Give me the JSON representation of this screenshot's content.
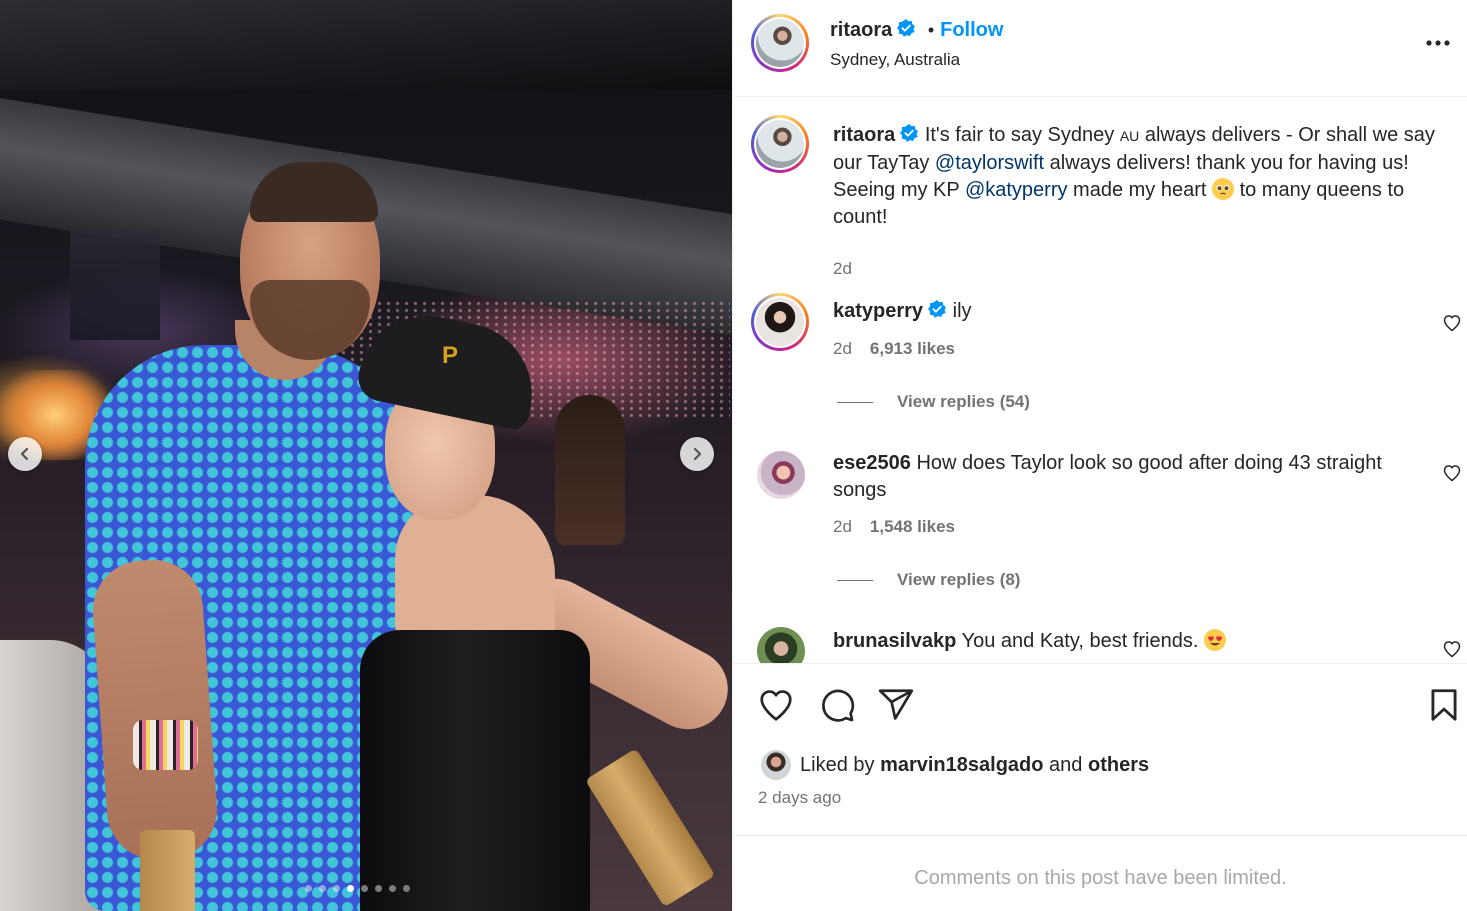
{
  "post": {
    "author": "ritaora",
    "follow_label": "Follow",
    "separator": "•",
    "location": "Sydney, Australia",
    "carousel": {
      "slide_count": 8,
      "active_index": 3
    }
  },
  "caption": {
    "username": "ritaora",
    "part1": "It's fair to say Sydney ",
    "flag_text": "AU",
    "part2": " always delivers - Or shall we say our TayTay ",
    "mention1": "@taylorswift",
    "part3": " always delivers! thank you for having us! Seeing my KP ",
    "mention2": "@katyperry",
    "part4": " made my heart ",
    "part5": " to many queens to count!",
    "time": "2d"
  },
  "comments": [
    {
      "username": "katyperry",
      "text": "ily",
      "time": "2d",
      "likes": "6,913 likes",
      "replies": "View replies (54)",
      "verified": true
    },
    {
      "username": "ese2506",
      "text": "How does Taylor look so good after doing 43 straight songs",
      "time": "2d",
      "likes": "1,548 likes",
      "replies": "View replies (8)",
      "verified": false
    },
    {
      "username": "brunasilvakp",
      "text": "You and Katy, best friends. ",
      "verified": false
    }
  ],
  "likes": {
    "prefix": "Liked by ",
    "user": "marvin18salgado",
    "middle": " and ",
    "others": "others"
  },
  "date": "2 days ago",
  "limited": "Comments on this post have been limited.",
  "colors": {
    "link": "#0095f6",
    "mention": "#00376b",
    "muted": "#737373",
    "verified": "#0095f6"
  }
}
